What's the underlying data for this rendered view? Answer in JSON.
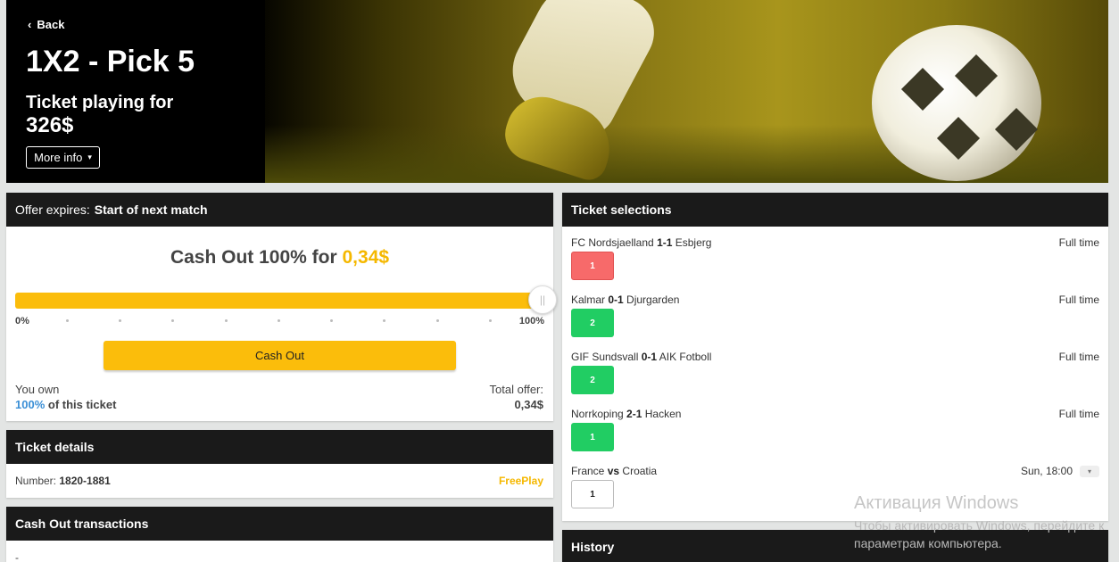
{
  "hero": {
    "back_label": "Back",
    "title": "1X2 - Pick 5",
    "subtitle": "Ticket playing for",
    "amount": "326$",
    "more_info_label": "More info"
  },
  "cashout": {
    "offer_label": "Offer expires:",
    "offer_value": "Start of next match",
    "title_prefix": "Cash Out 100% for",
    "title_amount": "0,34$",
    "slider_min": "0%",
    "slider_max": "100%",
    "slider_value_pct": 100,
    "button_label": "Cash Out",
    "own_label": "You own",
    "own_pct": "100%",
    "own_suffix": "of this ticket",
    "total_label": "Total offer:",
    "total_value": "0,34$"
  },
  "details": {
    "title": "Ticket details",
    "number_label": "Number:",
    "number_value": "1820-1881",
    "badge": "FreePlay"
  },
  "transactions": {
    "title": "Cash Out transactions",
    "empty": "-"
  },
  "selections": {
    "title": "Ticket selections",
    "items": [
      {
        "home": "FC Nordsjaelland",
        "score": "1-1",
        "away": "Esbjerg",
        "time": "Full time",
        "pick": "1",
        "state": "red"
      },
      {
        "home": "Kalmar",
        "score": "0-1",
        "away": "Djurgarden",
        "time": "Full time",
        "pick": "2",
        "state": "green"
      },
      {
        "home": "GIF Sundsvall",
        "score": "0-1",
        "away": "AIK Fotboll",
        "time": "Full time",
        "pick": "2",
        "state": "green"
      },
      {
        "home": "Norrkoping",
        "score": "2-1",
        "away": "Hacken",
        "time": "Full time",
        "pick": "1",
        "state": "green"
      },
      {
        "home": "France",
        "score": "vs",
        "away": "Croatia",
        "time": "Sun, 18:00",
        "pick": "1",
        "state": "open"
      }
    ]
  },
  "history": {
    "title": "History"
  },
  "watermark": {
    "title": "Активация Windows",
    "line1": "Чтобы активировать Windows, перейдите к",
    "line2": "параметрам компьютера."
  },
  "colors": {
    "accent_yellow": "#fbbd0b",
    "win_green": "#21cd63",
    "loss_red": "#f76a6a",
    "link_blue": "#3b8fd6",
    "header_dark": "#1a1a1a"
  }
}
